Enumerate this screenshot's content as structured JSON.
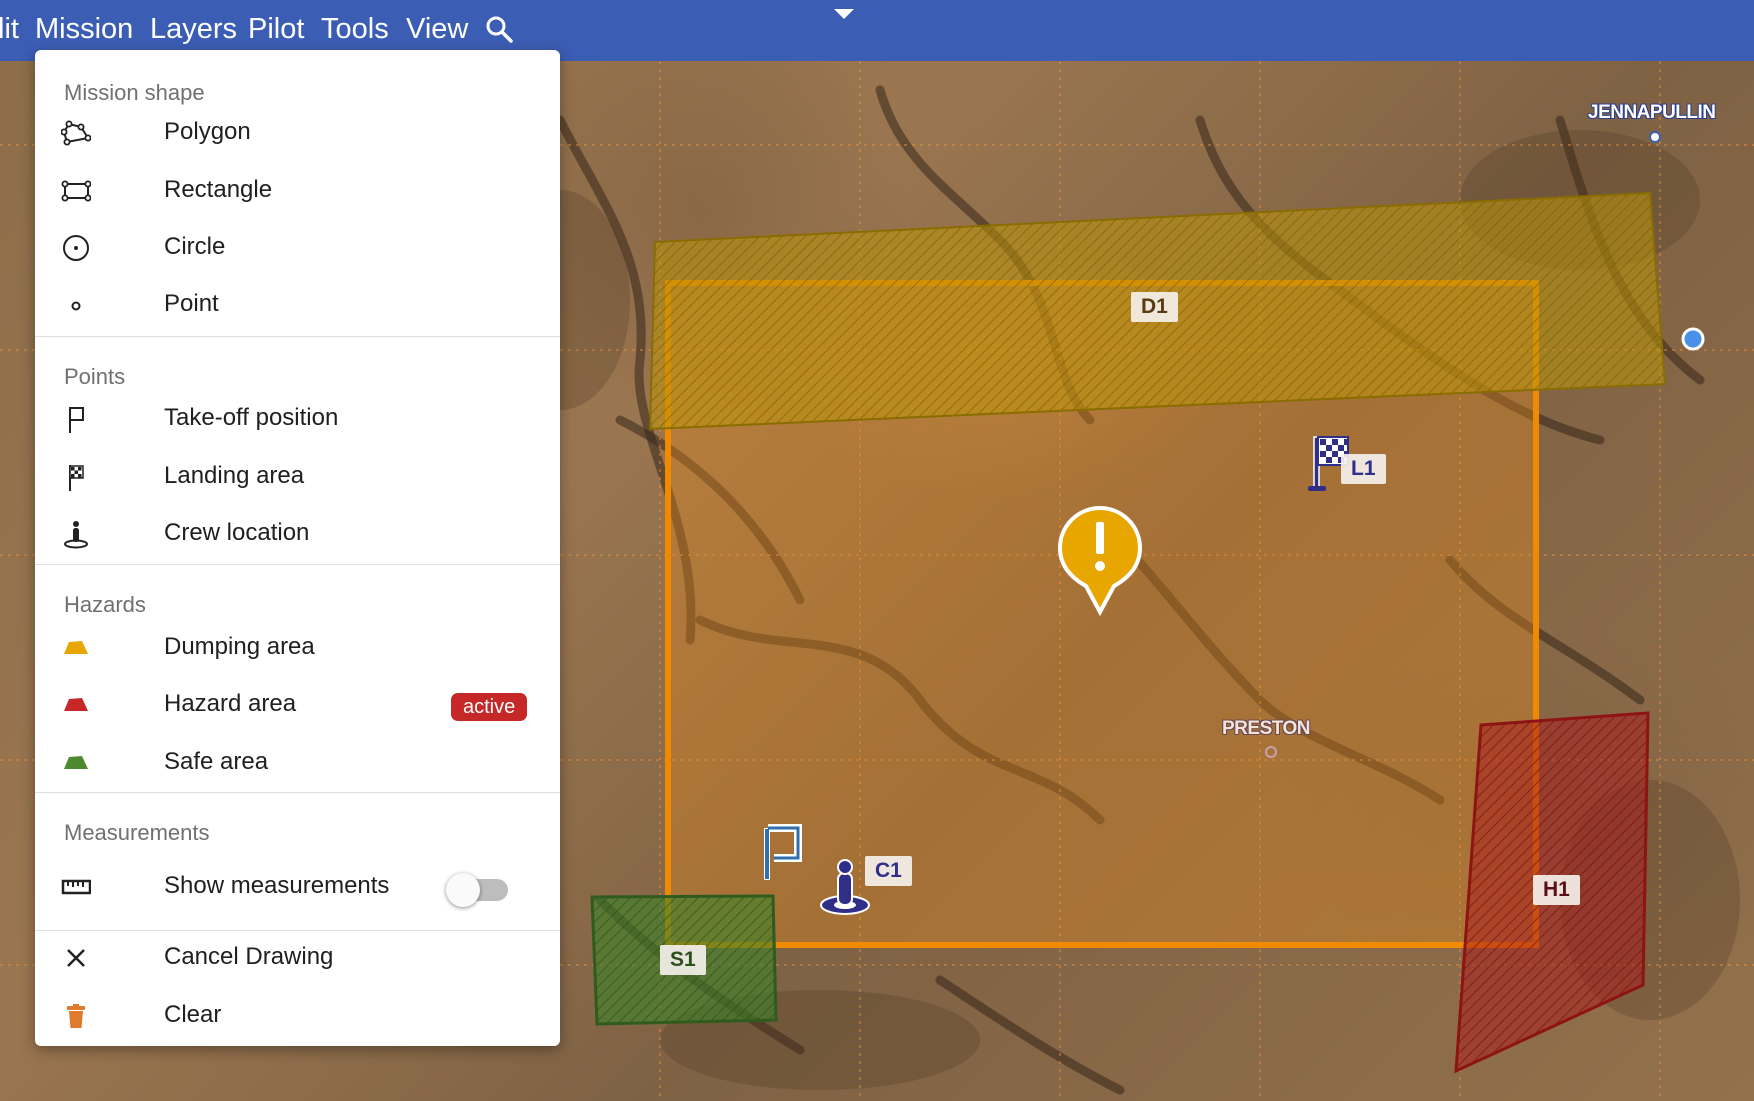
{
  "menubar": {
    "items": [
      "lit",
      "Mission",
      "Layers",
      "Pilot",
      "Tools",
      "View"
    ],
    "search_icon": "search-icon",
    "caret_icon": "caret-down-icon",
    "color": "#3b5db3"
  },
  "menu": {
    "sections": {
      "shape": {
        "title": "Mission shape",
        "items": [
          {
            "label": "Polygon",
            "icon": "polygon-icon"
          },
          {
            "label": "Rectangle",
            "icon": "rectangle-icon"
          },
          {
            "label": "Circle",
            "icon": "circle-icon"
          },
          {
            "label": "Point",
            "icon": "point-icon"
          }
        ]
      },
      "points": {
        "title": "Points",
        "items": [
          {
            "label": "Take-off position",
            "icon": "takeoff-flag-icon"
          },
          {
            "label": "Landing area",
            "icon": "checkered-flag-icon"
          },
          {
            "label": "Crew location",
            "icon": "crew-icon"
          }
        ]
      },
      "hazards": {
        "title": "Hazards",
        "items": [
          {
            "label": "Dumping area",
            "icon": "dumping-area-icon",
            "color": "#e8a600"
          },
          {
            "label": "Hazard area",
            "icon": "hazard-area-icon",
            "color": "#c62828",
            "badge": "active"
          },
          {
            "label": "Safe area",
            "icon": "safe-area-icon",
            "color": "#4d8a2f"
          }
        ]
      },
      "measurements": {
        "title": "Measurements",
        "items": [
          {
            "label": "Show measurements",
            "icon": "ruler-icon",
            "toggle": false
          }
        ]
      },
      "actions": {
        "items": [
          {
            "label": "Cancel Drawing",
            "icon": "close-icon"
          },
          {
            "label": "Clear",
            "icon": "trash-icon",
            "color": "#e07a2c"
          }
        ]
      }
    }
  },
  "map": {
    "labels": {
      "d1": "D1",
      "l1": "L1",
      "c1": "C1",
      "s1": "S1",
      "h1": "H1"
    },
    "places": {
      "jennapullin": "JENNAPULLIN",
      "preston": "PRESTON"
    },
    "colors": {
      "mission": "#f08a00",
      "dumping": "#c9a000",
      "hazard": "#b51f1f",
      "safe": "#3f7f2a",
      "marker": "#e8a600"
    },
    "marker_glyph": "!"
  }
}
